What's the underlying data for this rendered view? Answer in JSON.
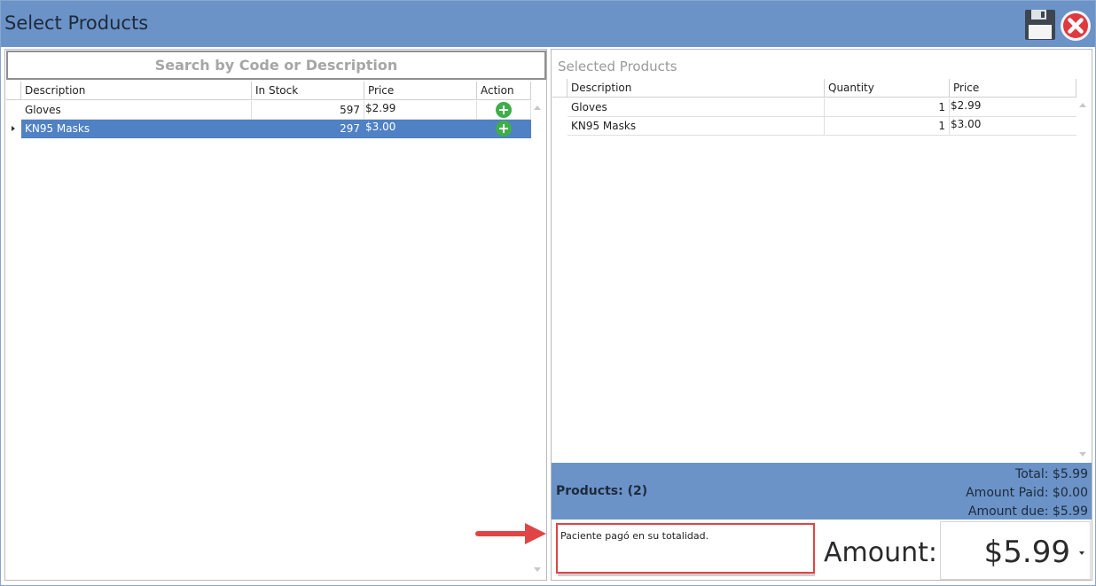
{
  "window": {
    "title": "Select Products"
  },
  "toolbar": {
    "save_icon": "floppy-disk-icon",
    "close_icon": "close-circle-icon"
  },
  "search": {
    "placeholder": "Search by Code or Description"
  },
  "products_grid": {
    "columns": [
      "Description",
      "In Stock",
      "Price",
      "Action"
    ],
    "rows": [
      {
        "description": "Gloves",
        "in_stock": "597",
        "price": "$2.99",
        "selected": false
      },
      {
        "description": "KN95 Masks",
        "in_stock": "297",
        "price": "$3.00",
        "selected": true
      }
    ]
  },
  "selected_panel": {
    "title": "Selected Products",
    "columns": [
      "Description",
      "Quantity",
      "Price"
    ],
    "rows": [
      {
        "description": "Gloves",
        "quantity": "1",
        "price": "$2.99"
      },
      {
        "description": "KN95 Masks",
        "quantity": "1",
        "price": "$3.00"
      }
    ]
  },
  "summary": {
    "products_count": "Products: (2)",
    "total": "Total: $5.99",
    "amount_paid": "Amount Paid: $0.00",
    "amount_due": "Amount due: $5.99"
  },
  "notes": {
    "value": "Paciente pagó en su totalidad."
  },
  "amount": {
    "label": "Amount:",
    "value": "$5.99"
  },
  "colors": {
    "header_blue": "#6b93c8",
    "selection_blue": "#4f81c4",
    "add_green": "#3fae49",
    "highlight_red": "#e04545"
  }
}
